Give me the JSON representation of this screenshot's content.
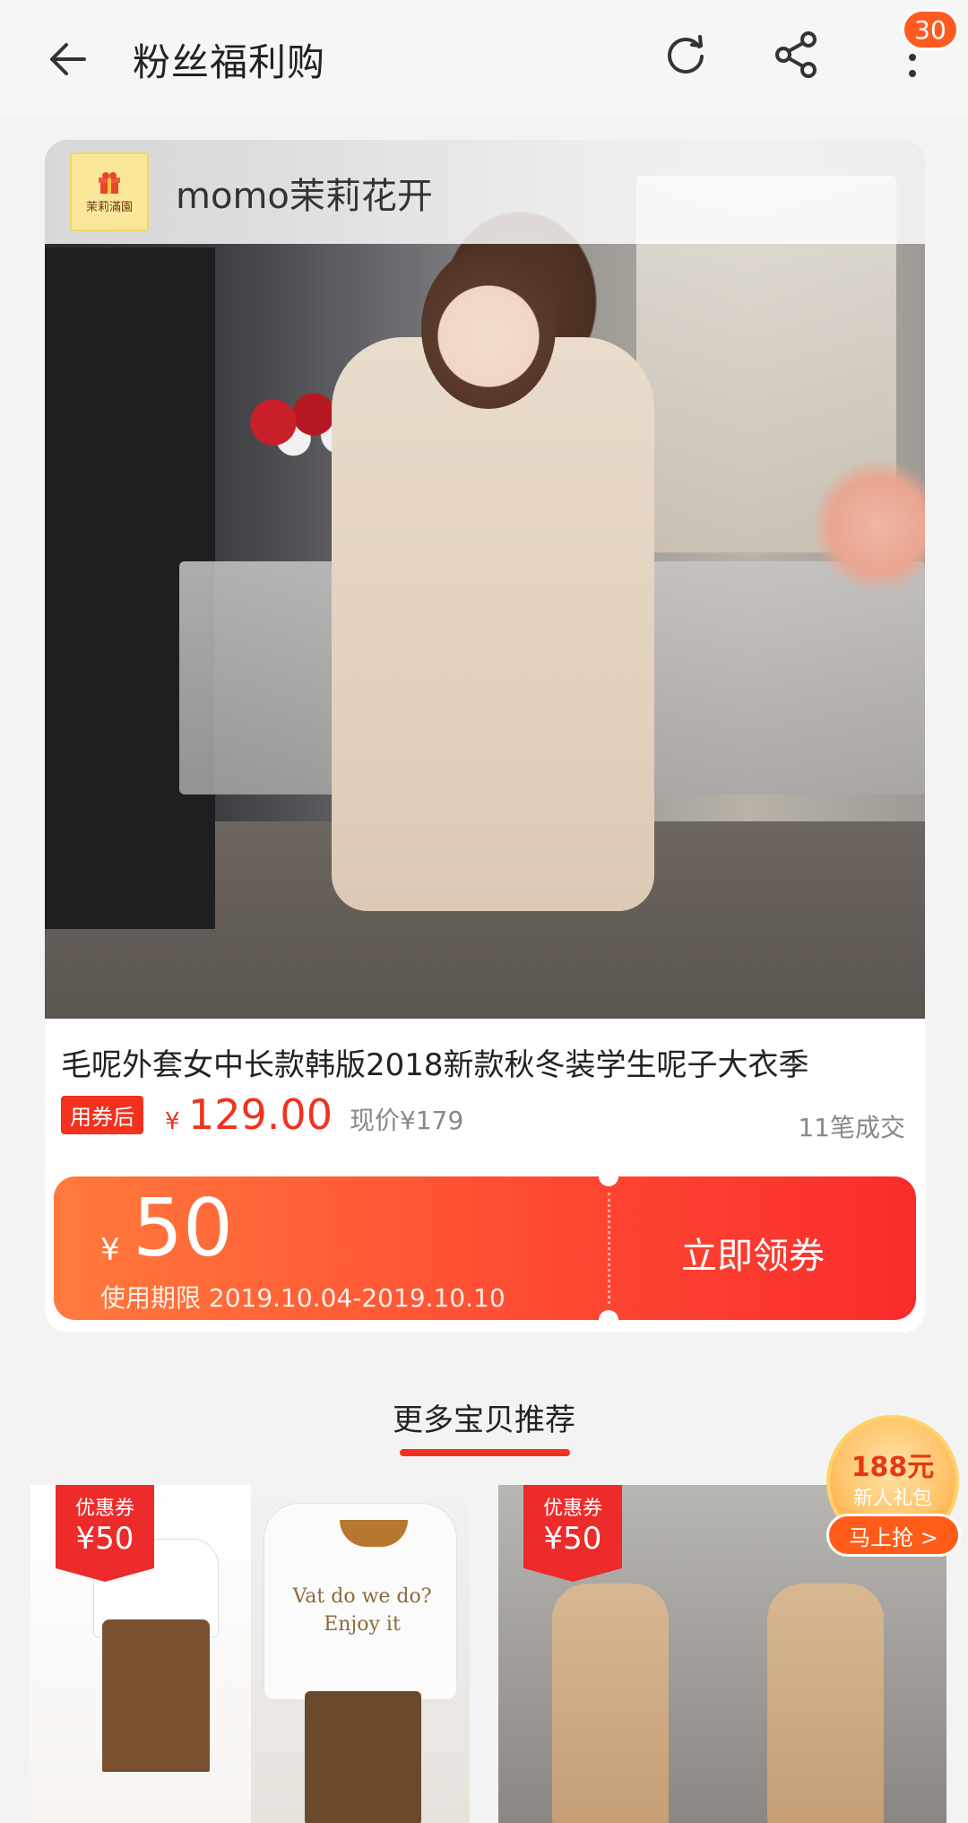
{
  "header": {
    "title": "粉丝福利购",
    "badge_count": "30"
  },
  "product": {
    "shop_name": "momo茉莉花开",
    "shop_logo_text": "茉莉滿園",
    "title": "毛呢外套女中长款韩版2018新款秋冬装学生呢子大衣季",
    "coupon_tag": "用券后",
    "price_currency": "¥",
    "price": "129.00",
    "original_price": "现价¥179",
    "sold": "11笔成交"
  },
  "coupon": {
    "yen": "¥",
    "amount": "50",
    "validity": "使用期限 2019.10.04-2019.10.10",
    "cta": "立即领券"
  },
  "recommend": {
    "title": "更多宝贝推荐",
    "items": [
      {
        "badge_line1": "优惠券",
        "badge_line2": "¥50"
      },
      {
        "sweater_text": "Vat do we do?\nEnjoy it"
      },
      {
        "badge_line1": "优惠券",
        "badge_line2": "¥50"
      }
    ]
  },
  "promo": {
    "amount": "188元",
    "subtitle": "新人礼包",
    "cta": "马上抢 >"
  },
  "colors": {
    "accent": "#f2311f",
    "badge": "#ff5a1f"
  }
}
